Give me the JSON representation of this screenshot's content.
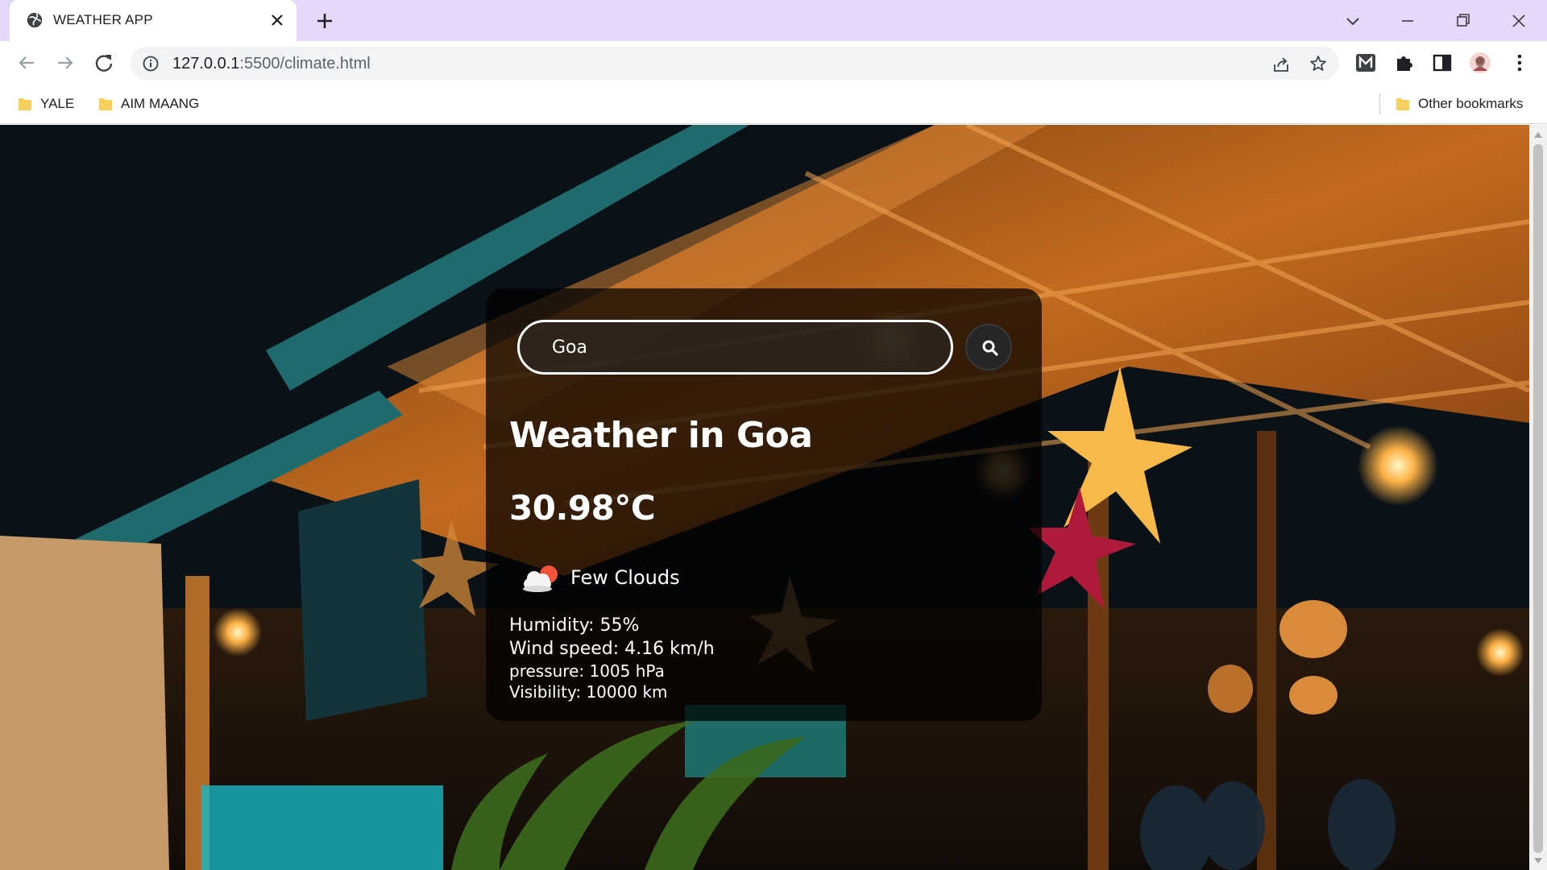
{
  "browser": {
    "tab": {
      "title": "WEATHER APP",
      "favicon": "globe-icon"
    },
    "url": {
      "host": "127.0.0.1",
      "rest": ":5500/climate.html"
    },
    "bookmarks": [
      {
        "label": "YALE",
        "icon": "folder-icon"
      },
      {
        "label": "AIM MAANG",
        "icon": "folder-icon"
      }
    ],
    "other_bookmarks": "Other bookmarks",
    "colors": {
      "tabstrip": "#e5d8fb",
      "toolbar": "#ffffff",
      "omnibox": "#f1f3f4"
    }
  },
  "weather": {
    "search": {
      "value": "Goa",
      "icon": "search-icon"
    },
    "city_heading": "Weather in Goa",
    "temperature": "30.98°C",
    "condition": {
      "icon": "few-clouds-icon",
      "text": "Few Clouds"
    },
    "humidity": "Humidity: 55%",
    "wind": "Wind speed: 4.16 km/h",
    "pressure": "pressure: 1005 hPa",
    "visibility": "Visibility: 10000 km"
  }
}
